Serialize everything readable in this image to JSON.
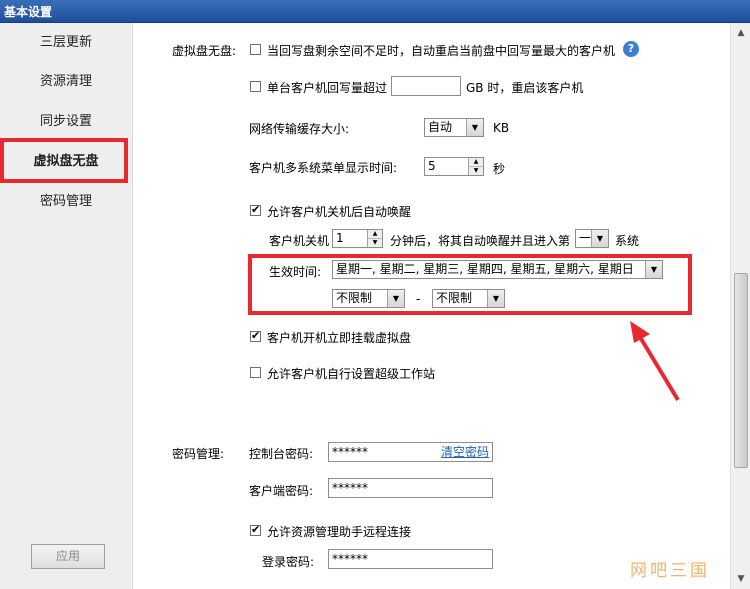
{
  "window": {
    "title": "基本设置"
  },
  "sidebar": {
    "items": [
      {
        "label": "三层更新"
      },
      {
        "label": "资源清理"
      },
      {
        "label": "同步设置"
      },
      {
        "label": "虚拟盘无盘"
      },
      {
        "label": "密码管理"
      }
    ],
    "apply_label": "应用"
  },
  "vdisk": {
    "section_label": "虚拟盘无盘:",
    "restart_low_space_label": "当回写盘剩余空间不足时，自动重启当前盘中回写量最大的客户机",
    "single_client_label": "单台客户机回写量超过",
    "single_client_value": "",
    "single_client_suffix": "GB 时，重启该客户机",
    "net_cache_label": "网络传输缓存大小:",
    "net_cache_value": "自动",
    "net_cache_unit": "KB",
    "menu_time_label": "客户机多系统菜单显示时间:",
    "menu_time_value": "5",
    "menu_time_unit": "秒",
    "auto_wake_label": "允许客户机关机后自动唤醒",
    "shutdown_prefix": "客户机关机",
    "shutdown_minutes": "1",
    "shutdown_middle": "分钟后，将其自动唤醒并且进入第",
    "system_index": "一",
    "system_suffix": "系统",
    "effective_label": "生效时间:",
    "effective_days": "星期一, 星期二, 星期三, 星期四, 星期五, 星期六, 星期日",
    "time_from": "不限制",
    "time_dash": "-",
    "time_to": "不限制",
    "mount_label": "客户机开机立即挂载虚拟盘",
    "super_ws_label": "允许客户机自行设置超级工作站"
  },
  "password": {
    "section_label": "密码管理:",
    "console_label": "控制台密码:",
    "console_value": "******",
    "clear_label": "清空密码",
    "client_label": "客户端密码:",
    "client_value": "******",
    "remote_label": "允许资源管理助手远程连接",
    "login_label": "登录密码:",
    "login_value": "******"
  },
  "watermark": "网吧三国",
  "colors": {
    "highlight": "#e8292f",
    "title_bar": "#2a5ea8",
    "link": "#1f62b7"
  }
}
